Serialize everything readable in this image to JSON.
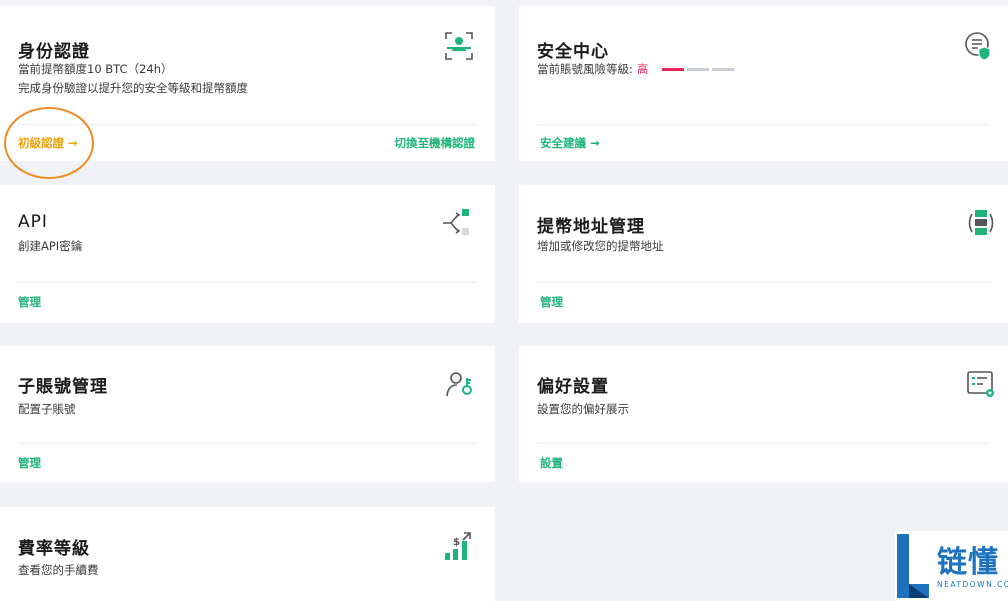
{
  "identity": {
    "title": "身份認證",
    "limit_text": "當前提幣額度10 BTC（24h）",
    "desc": "完成身份驗證以提升您的安全等級和提幣額度",
    "primary_link": "初級認證 →",
    "switch_link": "切換至機構認證",
    "icon": "face-scan-icon"
  },
  "security": {
    "title": "安全中心",
    "risk_label": "當前賬號風險等級:",
    "risk_level": "高",
    "link": "安全建議 →",
    "icon": "shield-doc-icon",
    "risk_color": "#e8265b"
  },
  "api": {
    "title": "API",
    "desc": "創建API密鑰",
    "link": "管理",
    "icon": "api-flow-icon"
  },
  "withdraw": {
    "title": "提幣地址管理",
    "desc": "增加或修改您的提幣地址",
    "link": "管理",
    "icon": "address-list-icon"
  },
  "subaccount": {
    "title": "子賬號管理",
    "desc": "配置子賬號",
    "link": "管理",
    "icon": "user-key-icon"
  },
  "preferences": {
    "title": "偏好設置",
    "desc": "設置您的偏好展示",
    "link": "設置",
    "icon": "settings-card-icon"
  },
  "fees": {
    "title": "費率等級",
    "desc": "查看您的手續費",
    "icon": "fee-chart-icon"
  },
  "watermark": {
    "brand": "链懂",
    "site": "NEATDOWN.COM"
  },
  "colors": {
    "accent_green": "#1fb57a",
    "accent_orange": "#f0a30a",
    "background": "#f0f2f5"
  }
}
